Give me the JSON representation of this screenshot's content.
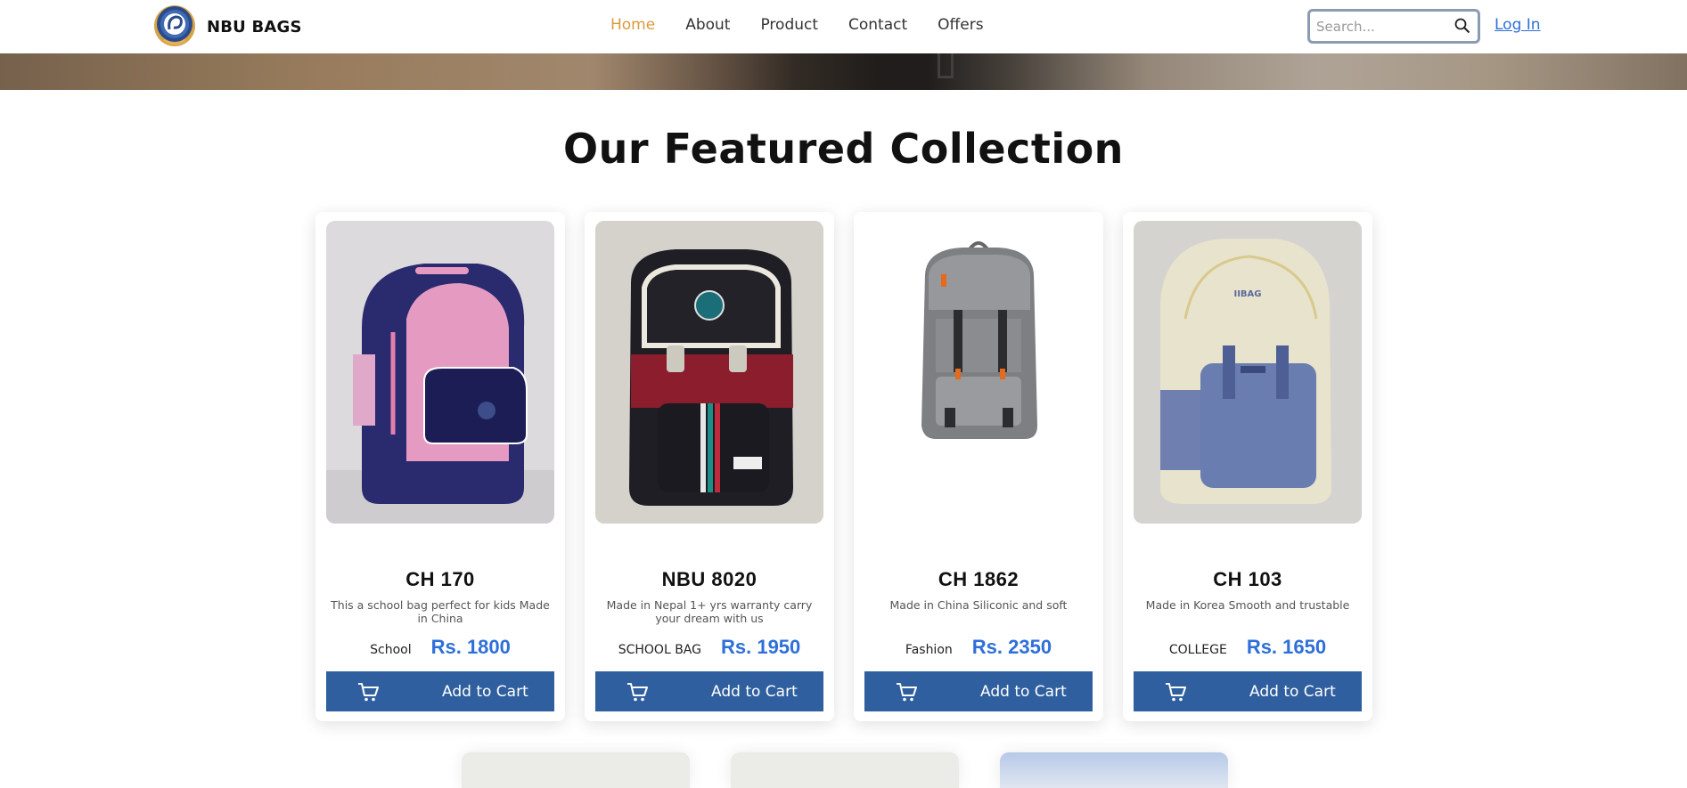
{
  "header": {
    "brand_name": "NBU BAGS",
    "nav": [
      "Home",
      "About",
      "Product",
      "Contact",
      "Offers"
    ],
    "active_nav": "Home",
    "search_placeholder": "Search...",
    "login_label": "Log In",
    "colors": {
      "active_nav": "#d99a3c",
      "link": "#2e6fd9"
    }
  },
  "section": {
    "title": "Our Featured Collection"
  },
  "products": [
    {
      "name": "CH 170",
      "description": "This a school bag perfect for kids Made in China",
      "category": "School",
      "price": "Rs. 1800",
      "button": "Add to Cart"
    },
    {
      "name": "NBU 8020",
      "description": "Made in Nepal 1+ yrs warranty carry your dream with us",
      "category": "SCHOOL BAG",
      "price": "Rs. 1950",
      "button": "Add to Cart"
    },
    {
      "name": "CH 1862",
      "description": "Made in China Siliconic and soft",
      "category": "Fashion",
      "price": "Rs. 2350",
      "button": "Add to Cart"
    },
    {
      "name": "CH 103",
      "description": "Made in Korea Smooth and trustable",
      "category": "COLLEGE",
      "price": "Rs. 1650",
      "button": "Add to Cart"
    }
  ],
  "colors": {
    "button": "#2f5f9e",
    "price": "#2e6fd9"
  }
}
